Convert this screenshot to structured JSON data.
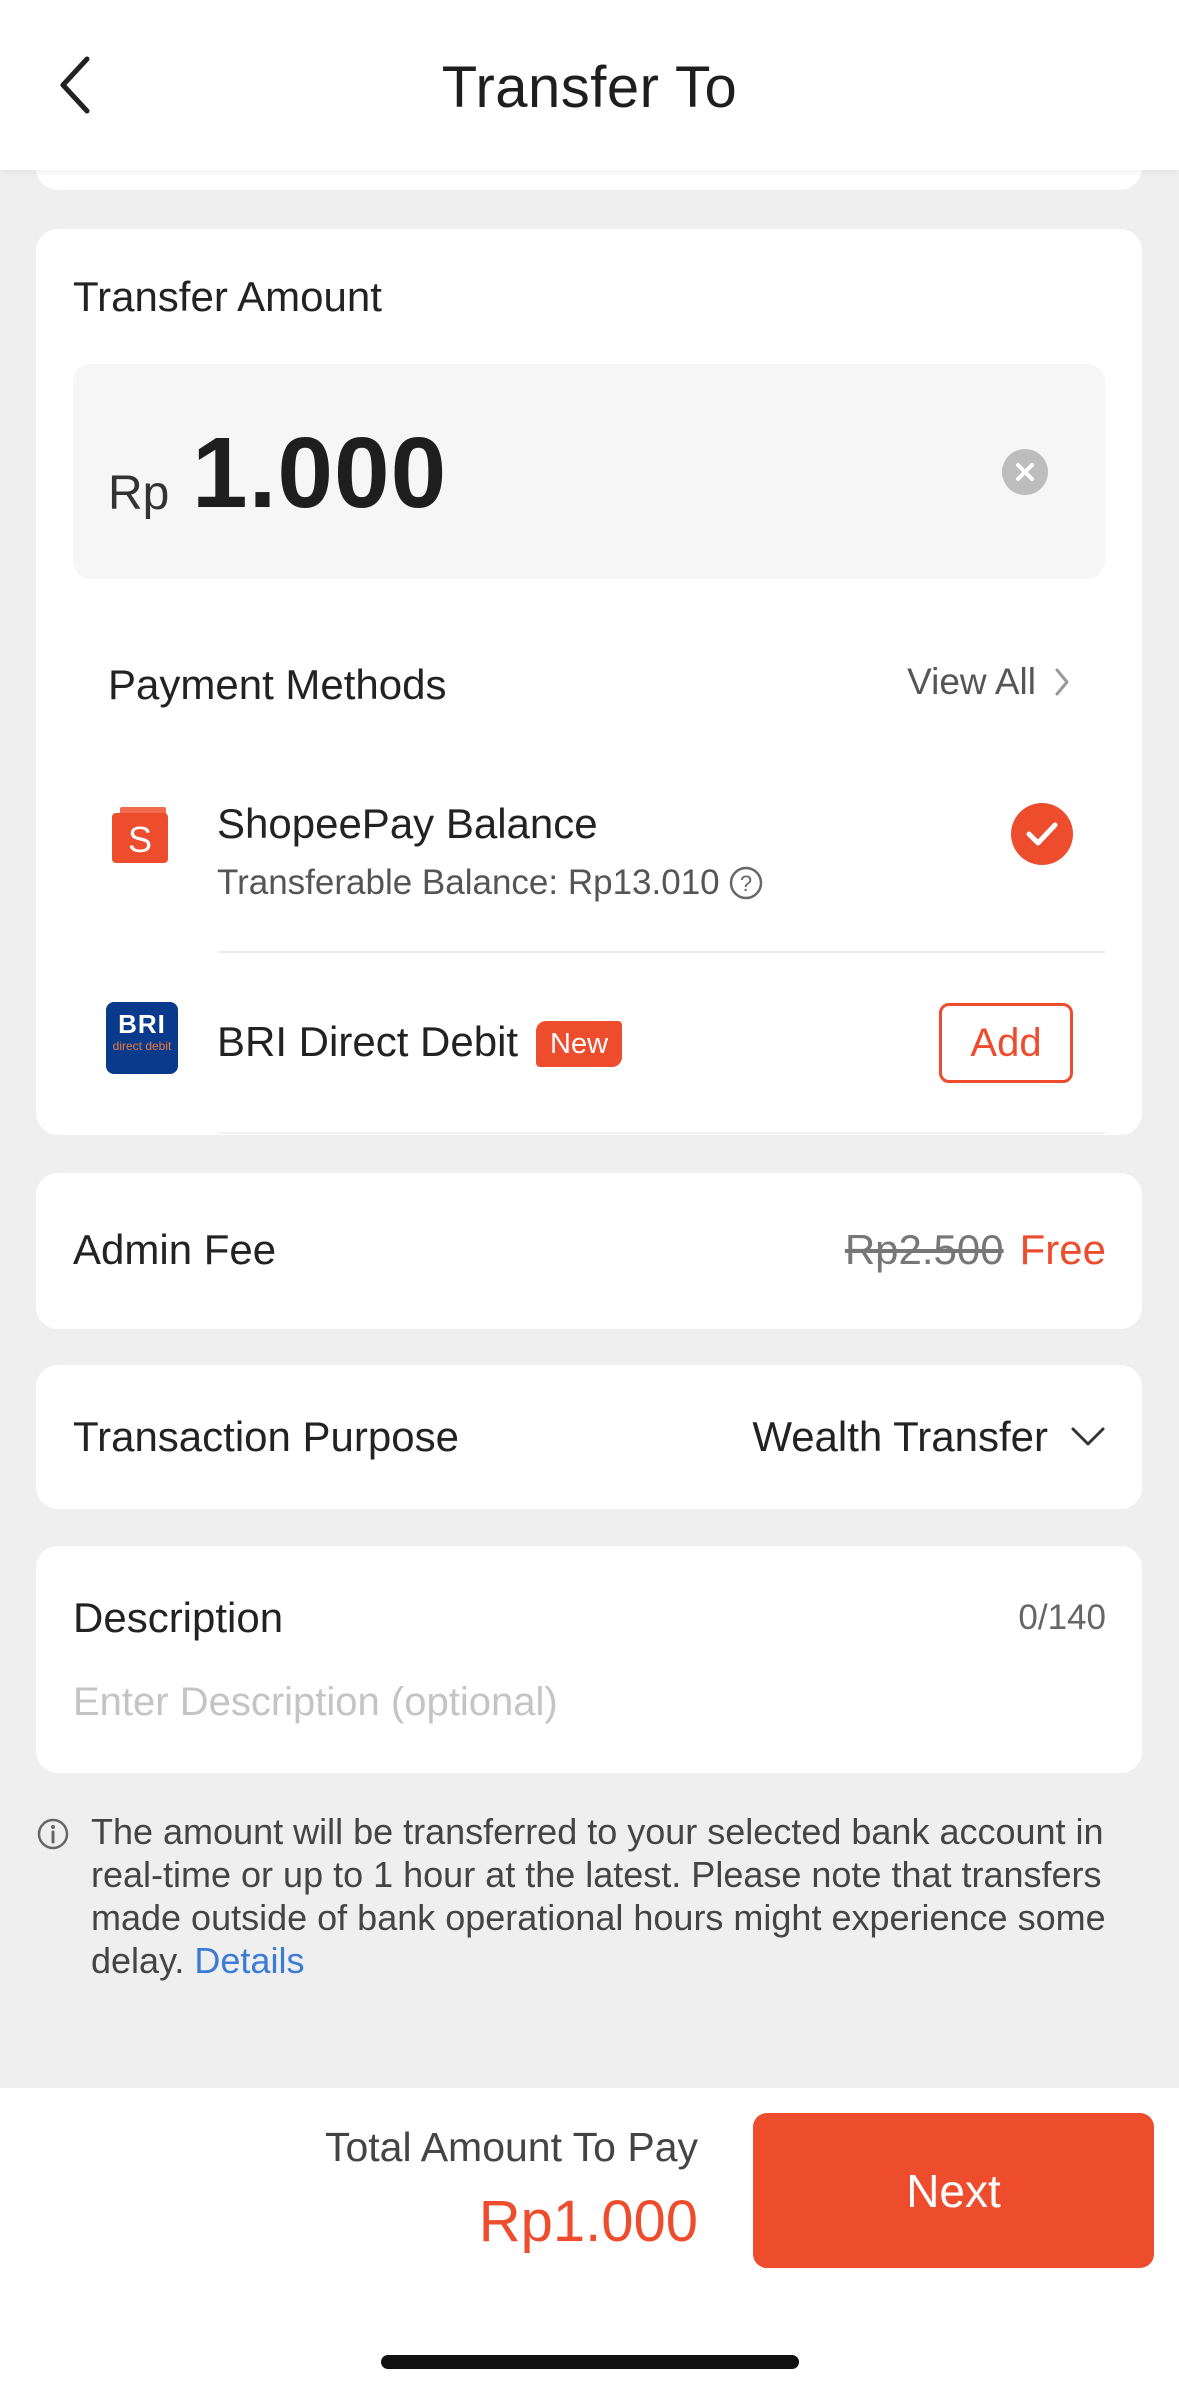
{
  "header": {
    "title": "Transfer To"
  },
  "amount": {
    "title": "Transfer Amount",
    "currency": "Rp",
    "value": "1.000"
  },
  "payment_methods": {
    "title": "Payment Methods",
    "view_all": "View All",
    "items": [
      {
        "name": "ShopeePay Balance",
        "sub": "Transferable Balance: Rp13.010",
        "selected": true,
        "icon": "shopeepay-icon"
      },
      {
        "name": "BRI Direct Debit",
        "badge": "New",
        "action": "Add",
        "icon": "bri-icon",
        "icon_text": "BRI",
        "icon_subtext": "direct debit"
      }
    ]
  },
  "admin_fee": {
    "label": "Admin Fee",
    "old": "Rp2.500",
    "new": "Free"
  },
  "purpose": {
    "label": "Transaction Purpose",
    "value": "Wealth Transfer"
  },
  "description": {
    "label": "Description",
    "counter": "0/140",
    "placeholder": "Enter Description (optional)",
    "value": ""
  },
  "notice": {
    "text": "The amount will be transferred to your selected bank account in real-time or up to 1 hour at the latest. Please note that transfers made outside of bank operational hours might experience some delay. ",
    "link": "Details"
  },
  "footer": {
    "total_label": "Total Amount To Pay",
    "total_value": "Rp1.000",
    "next": "Next"
  },
  "colors": {
    "accent": "#ee4d2d",
    "link": "#3b7bd4",
    "background": "#efefef",
    "bri_blue": "#0a3a8c"
  }
}
